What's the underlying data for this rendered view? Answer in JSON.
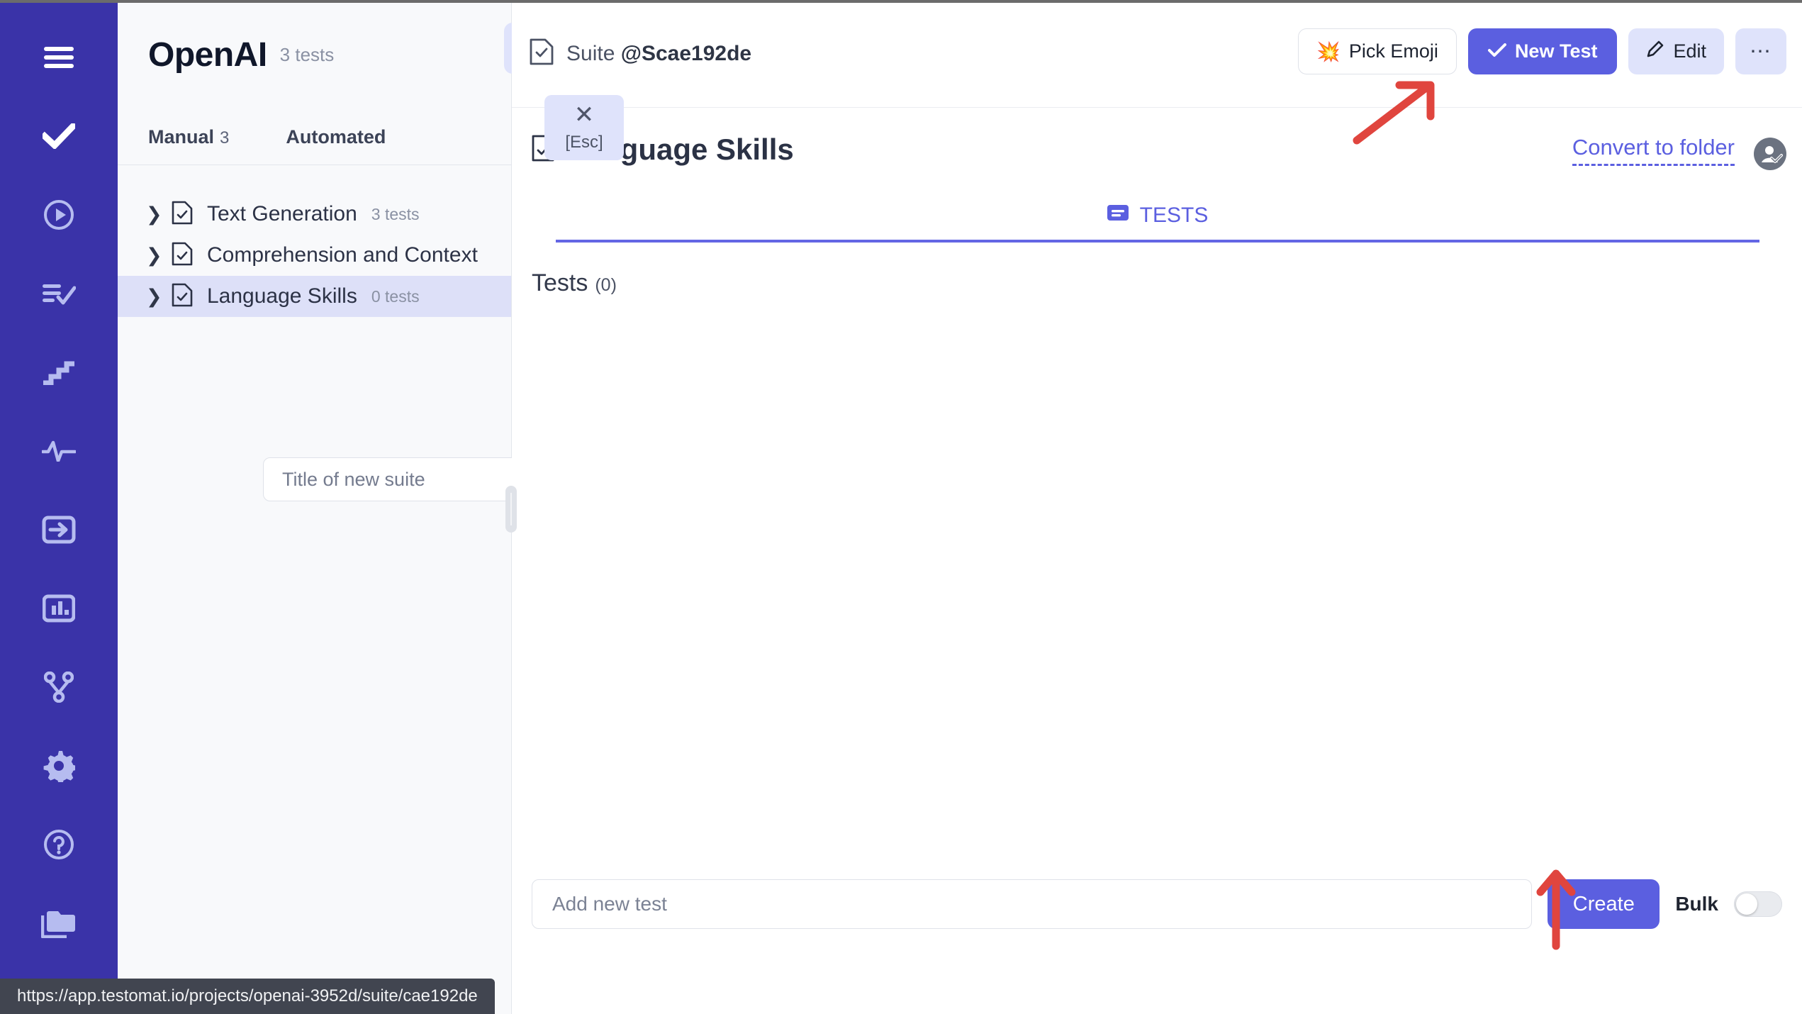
{
  "sidebar": {
    "items": [
      {
        "icon": "hamburger-menu-icon",
        "name": "menu"
      },
      {
        "icon": "checkmark-icon",
        "name": "tests"
      },
      {
        "icon": "play-circle-icon",
        "name": "runs"
      },
      {
        "icon": "list-check-icon",
        "name": "plans"
      },
      {
        "icon": "stairs-icon",
        "name": "steps"
      },
      {
        "icon": "pulse-icon",
        "name": "activity"
      },
      {
        "icon": "login-arrow-icon",
        "name": "import"
      },
      {
        "icon": "bar-chart-icon",
        "name": "reports"
      },
      {
        "icon": "branch-icon",
        "name": "branches"
      },
      {
        "icon": "gear-icon",
        "name": "settings"
      },
      {
        "icon": "question-circle-icon",
        "name": "help"
      },
      {
        "icon": "folders-icon",
        "name": "projects"
      }
    ]
  },
  "panel": {
    "brand": "OpenAI",
    "brand_count": "3 tests",
    "filter_icon": "filter-funnel-icon",
    "search_icon": "search-icon",
    "search_placeholder": "",
    "esc": {
      "close_icon": "close-x-icon",
      "label": "[Esc]"
    },
    "tabs": [
      {
        "label": "Manual",
        "count": "3",
        "active": true
      },
      {
        "label": "Automated",
        "count": "",
        "active": false
      }
    ],
    "tree": [
      {
        "label": "Text Generation",
        "count": "3 tests",
        "active": false,
        "icon": "suite-file-icon",
        "chevron": "chevron-right-icon"
      },
      {
        "label": "Comprehension and Context",
        "count": "",
        "active": false,
        "icon": "suite-file-icon",
        "chevron": "chevron-right-icon"
      },
      {
        "label": "Language Skills",
        "count": "0 tests",
        "active": true,
        "icon": "suite-file-icon",
        "chevron": "chevron-right-icon"
      }
    ],
    "new_suite_placeholder": "Title of new suite"
  },
  "main": {
    "breadcrumb": {
      "icon": "suite-check-icon",
      "prefix": "Suite ",
      "id": "@Scae192de"
    },
    "actions": {
      "pick_emoji": {
        "label": "Pick Emoji",
        "emoji": "💥"
      },
      "new_test": {
        "label": "New Test",
        "icon": "check-icon"
      },
      "edit": {
        "label": "Edit",
        "icon": "pencil-icon"
      },
      "more": {
        "icon": "ellipsis-icon"
      }
    },
    "page_title": "Language Skills",
    "page_title_icon": "suite-file-icon",
    "convert_link": "Convert to folder",
    "avatar_icon": "user-check-avatar-icon",
    "tab": {
      "label": "TESTS",
      "icon": "tests-list-icon"
    },
    "tests_header": {
      "label": "Tests",
      "count": "(0)"
    },
    "add_test_placeholder": "Add new test",
    "create_label": "Create",
    "bulk_label": "Bulk",
    "bulk_on": false
  },
  "statusbar": {
    "url": "https://app.testomat.io/projects/openai-3952d/suite/cae192de"
  },
  "colors": {
    "rail": "#3a33a8",
    "accent": "#5b5fe0",
    "accent_soft": "#dfe3fb",
    "panel_bg": "#f8f9fb",
    "annotation": "#e0453e"
  }
}
